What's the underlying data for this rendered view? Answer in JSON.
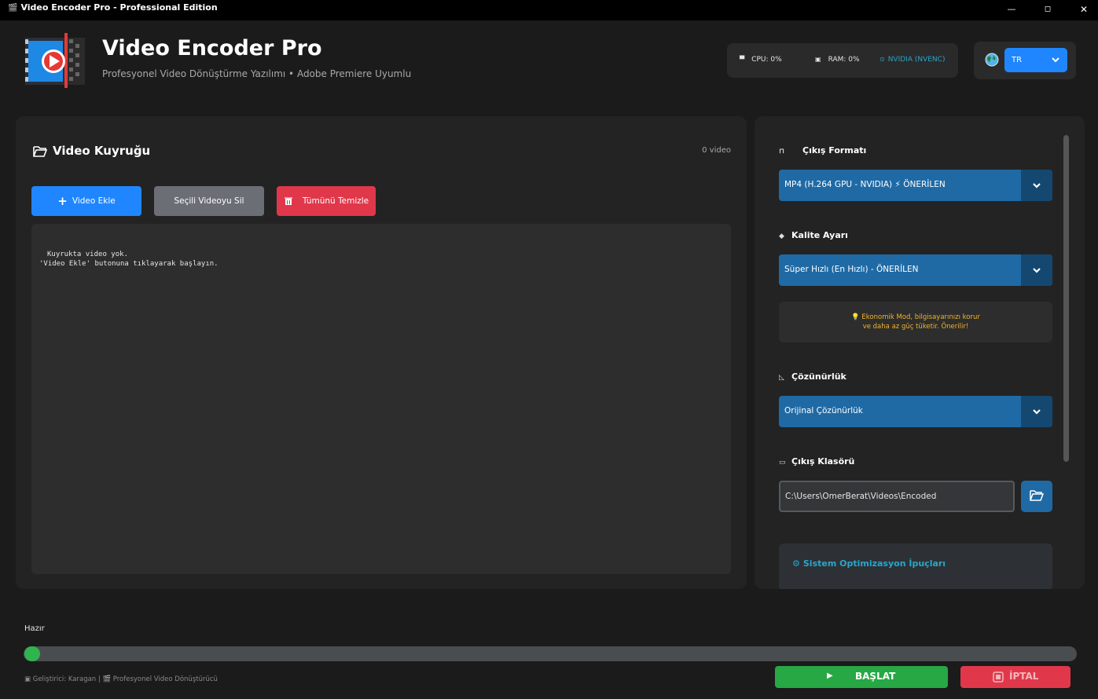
{
  "window": {
    "title": "Video Encoder Pro - Professional Edition",
    "min": "—",
    "max": "◻",
    "close": "✕"
  },
  "header": {
    "title": "Video Encoder Pro",
    "subtitle": "Profesyonel Video Dönüştürme Yazılımı • Adobe Premiere Uyumlu"
  },
  "system": {
    "cpu": "CPU: 0%",
    "ram": "RAM: 0%",
    "gpu": "NVIDIA (NVENC)"
  },
  "language": {
    "selected": "TR"
  },
  "queue": {
    "title": "Video Kuyruğu",
    "count": "0 video",
    "add_label": "Video Ekle",
    "delete_label": "Seçili Videoyu Sil",
    "clear_label": "Tümünü Temizle",
    "empty_line1": "Kuyrukta video yok.",
    "empty_line2": "'Video Ekle' butonuna tıklayarak başlayın."
  },
  "settings": {
    "format_label": "Çıkış Formatı",
    "format_value": "MP4 (H.264 GPU - NVIDIA)  ⚡ ÖNERİLEN",
    "quality_label": "Kalite Ayarı",
    "quality_value": "Süper Hızlı (En Hızlı) - ÖNERİLEN",
    "tip_line1": "💡 Ekonomik Mod, bilgisayarınızı korur",
    "tip_line2": "ve daha az güç tüketir. Önerilir!",
    "resolution_label": "Çözünürlük",
    "resolution_value": "Orijinal Çözünürlük",
    "output_label": "Çıkış Klasörü",
    "output_path": "C:\\Users\\OmerBerat\\Videos\\Encoded",
    "optimization_title": "Sistem Optimizasyon İpuçları"
  },
  "status": {
    "text": "Hazır",
    "progress": 0
  },
  "footer": {
    "text": "Geliştirici: Karagan | 🎬 Profesyonel Video Dönüştürücü"
  },
  "actions": {
    "start_label": "BAŞLAT",
    "cancel_label": "İPTAL"
  },
  "colors": {
    "primary": "#1f86ff",
    "danger": "#e0384a",
    "success": "#28a745",
    "accent_dropdown": "#1f6aa5",
    "info": "#2aa6c9",
    "tip": "#f0b429"
  }
}
